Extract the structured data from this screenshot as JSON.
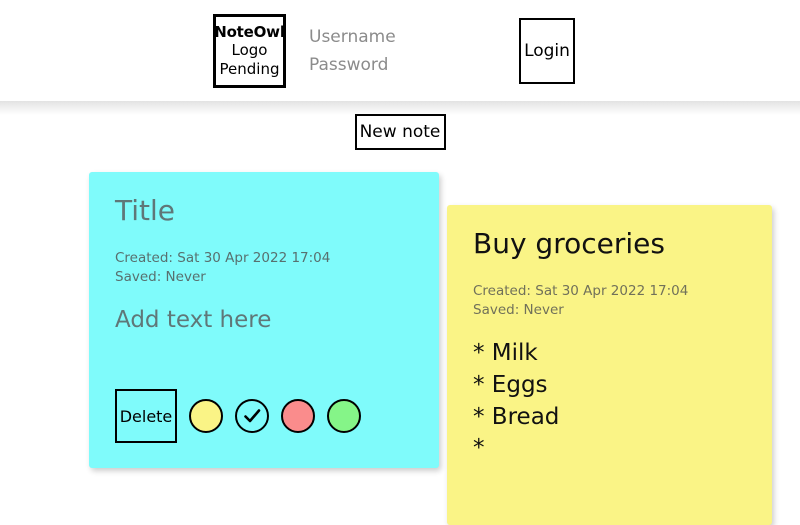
{
  "header": {
    "logo": {
      "line1": "NoteOwl",
      "line2": "Logo",
      "line3": "Pending"
    },
    "username_placeholder": "Username",
    "username_value": "",
    "password_placeholder": "Password",
    "password_value": "",
    "login_label": "Login"
  },
  "toolbar": {
    "new_note_label": "New note"
  },
  "notes": [
    {
      "title": "Title",
      "title_is_placeholder": true,
      "created": "Created: Sat 30 Apr 2022 17:04",
      "saved": "Saved: Never",
      "body": "Add text here",
      "body_is_placeholder": true,
      "background": "#7ffbfb",
      "delete_label": "Delete",
      "swatches": [
        {
          "name": "yellow",
          "color": "#faf486",
          "selected": false
        },
        {
          "name": "cyan",
          "color": "#7ffbfb",
          "selected": true
        },
        {
          "name": "red",
          "color": "#fa8c8c",
          "selected": false
        },
        {
          "name": "green",
          "color": "#85f588",
          "selected": false
        }
      ]
    },
    {
      "title": "Buy groceries",
      "title_is_placeholder": false,
      "created": "Created: Sat 30 Apr 2022 17:04",
      "saved": "Saved: Never",
      "body": "* Milk\n* Eggs\n* Bread\n*",
      "body_is_placeholder": false,
      "background": "#faf486"
    }
  ]
}
